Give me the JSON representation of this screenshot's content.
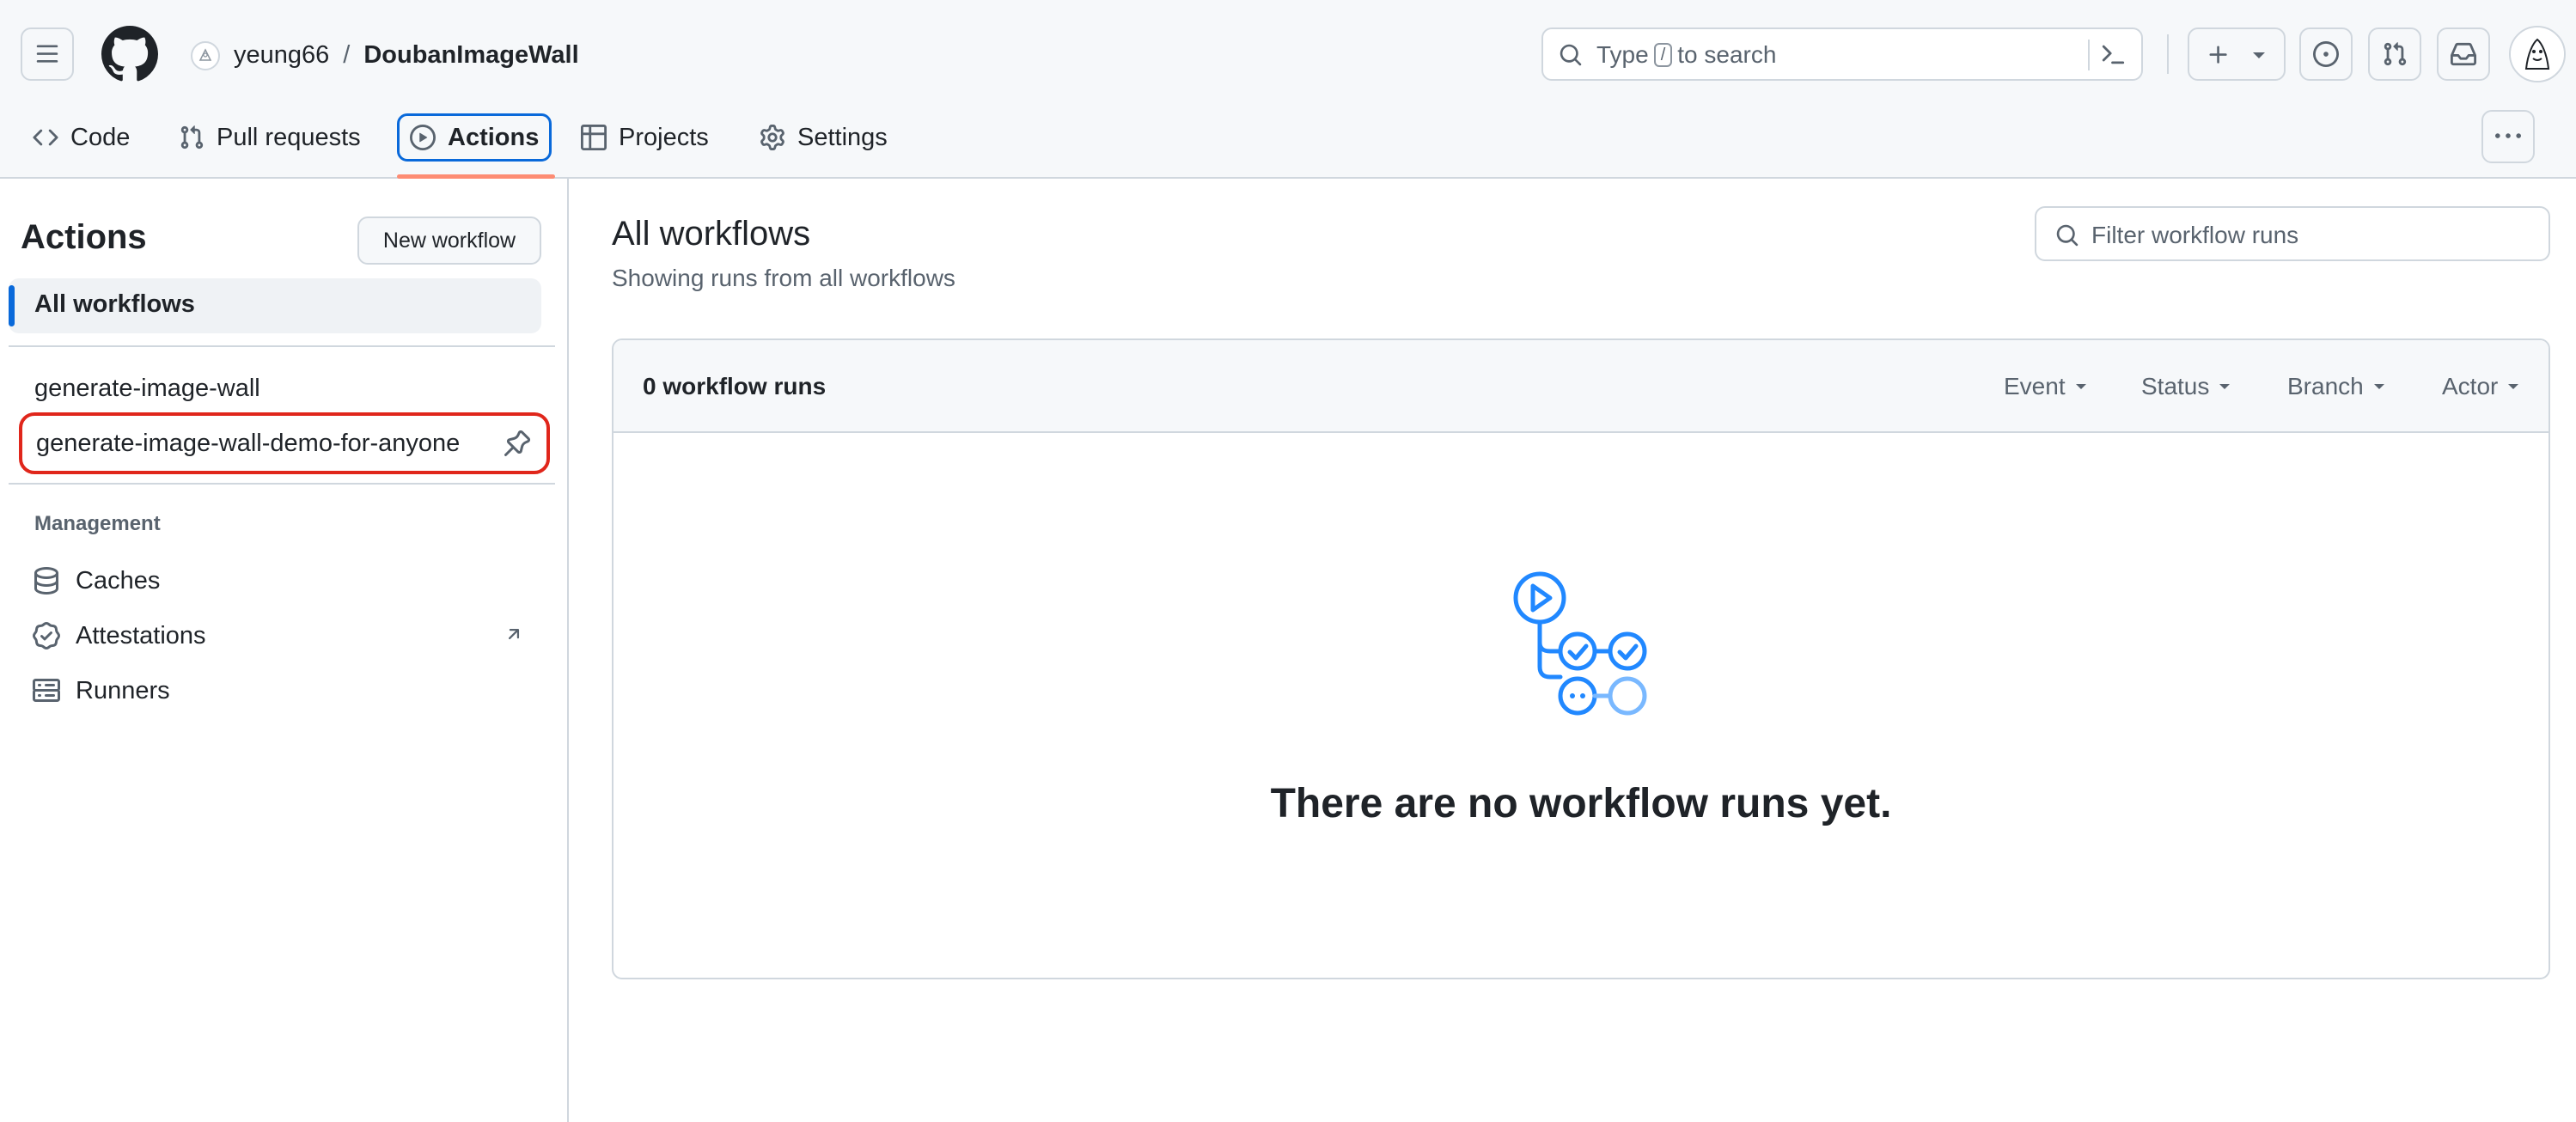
{
  "header": {
    "owner": "yeung66",
    "separator": "/",
    "repo": "DoubanImageWall",
    "search": {
      "prefix": "Type",
      "key": "/",
      "suffix": "to search"
    },
    "icons": [
      "menu-icon",
      "github-logo-icon",
      "search-icon",
      "command-palette-icon",
      "plus-icon",
      "triangle-down-icon",
      "issue-opened-icon",
      "git-pull-request-icon",
      "inbox-icon",
      "avatar"
    ]
  },
  "tabs": [
    {
      "label": "Code",
      "icon": "code-icon"
    },
    {
      "label": "Pull requests",
      "icon": "git-pull-request-icon"
    },
    {
      "label": "Actions",
      "icon": "play-icon",
      "active": true
    },
    {
      "label": "Projects",
      "icon": "table-icon"
    },
    {
      "label": "Settings",
      "icon": "gear-icon"
    }
  ],
  "sidebar": {
    "title": "Actions",
    "new_workflow": "New workflow",
    "all_workflows": "All workflows",
    "workflows": [
      "generate-image-wall",
      "generate-image-wall-demo-for-anyone"
    ],
    "management_title": "Management",
    "management": [
      {
        "label": "Caches",
        "icon": "database-icon"
      },
      {
        "label": "Attestations",
        "icon": "verified-icon"
      },
      {
        "label": "Runners",
        "icon": "server-icon"
      }
    ]
  },
  "main": {
    "title": "All workflows",
    "subtitle": "Showing runs from all workflows",
    "filter_placeholder": "Filter workflow runs",
    "runs_count": "0 workflow runs",
    "filters": [
      "Event",
      "Status",
      "Branch",
      "Actor"
    ],
    "empty_message": "There are no workflow runs yet."
  },
  "colors": {
    "accent": "#0969da",
    "highlight": "#e0261b",
    "tab_underline": "#fd8c73",
    "illustration": "#2188ff"
  }
}
